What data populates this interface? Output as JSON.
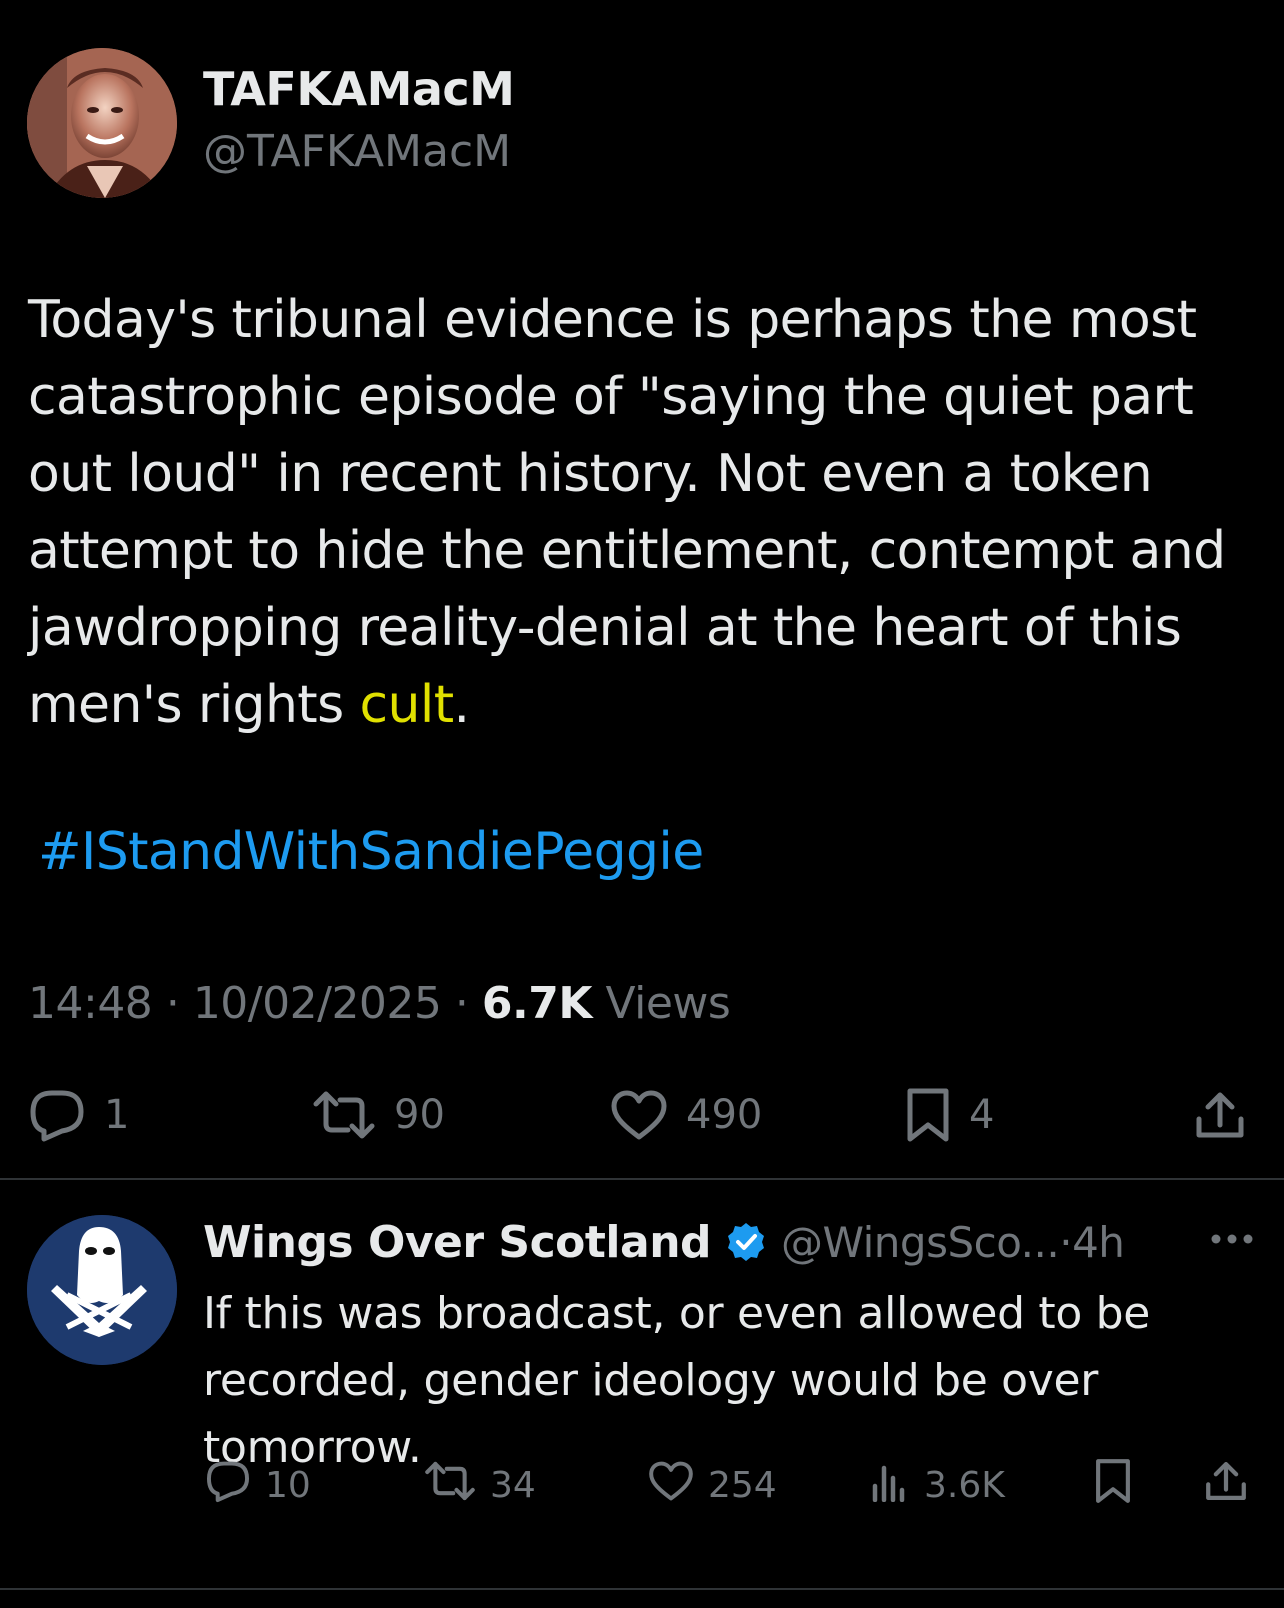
{
  "main_tweet": {
    "author_name": "TAFKAMacM",
    "author_handle": "@TAFKAMacM",
    "text_before": "Today's tribunal evidence is perhaps the most catastrophic episode of \"saying the quiet part out loud\" in recent history.  Not even a token attempt  to hide the entitlement, contempt and jawdropping reality-denial at the heart of this men's rights ",
    "text_highlight": "cult",
    "text_after": ".",
    "hashtag": "#IStandWithSandiePeggie",
    "time": "14:48",
    "date": "10/02/2025",
    "views_count": "6.7K",
    "views_label": "Views",
    "replies": "1",
    "reposts": "90",
    "likes": "490",
    "bookmarks": "4",
    "colors": {
      "highlight": "#e0e000",
      "hashtag": "#1d9bf0"
    }
  },
  "reply": {
    "author_name": "Wings Over Scotland",
    "author_handle": "@WingsSco...",
    "time_ago": "4h",
    "text": "If this was broadcast, or even allowed to be recorded, gender ideology would be over tomorrow.",
    "replies": "10",
    "reposts": "34",
    "likes": "254",
    "views": "3.6K",
    "colors": {
      "verified": "#1d9bf0"
    }
  },
  "separator": "·"
}
